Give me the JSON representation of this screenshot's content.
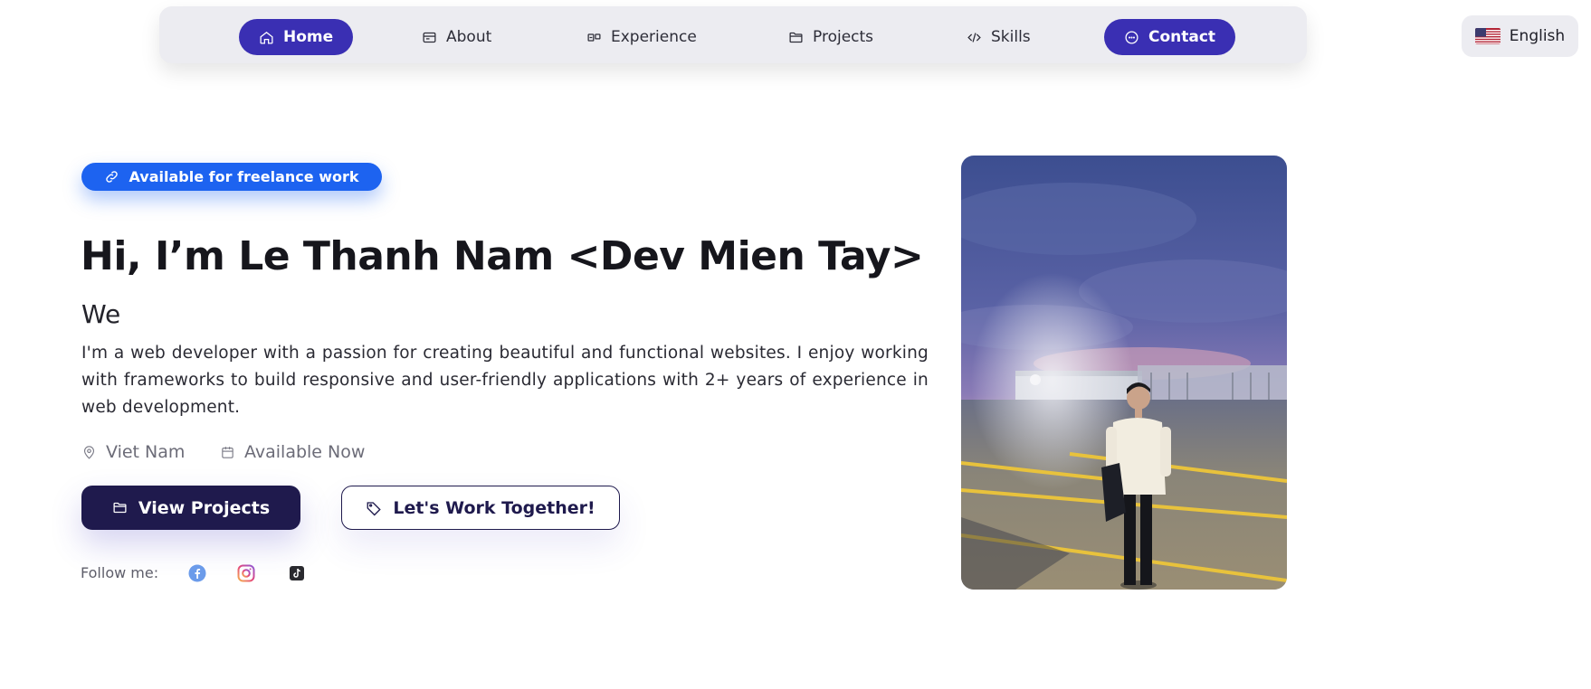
{
  "nav": {
    "items": [
      {
        "label": "Home",
        "icon": "home-icon"
      },
      {
        "label": "About",
        "icon": "id-card-icon"
      },
      {
        "label": "Experience",
        "icon": "briefcase-icon"
      },
      {
        "label": "Projects",
        "icon": "folder-icon"
      },
      {
        "label": "Skills",
        "icon": "code-icon"
      },
      {
        "label": "Contact",
        "icon": "chat-icon"
      }
    ],
    "active_color": "#3a2fb3"
  },
  "language": {
    "label": "English",
    "icon": "us-flag-icon"
  },
  "hero": {
    "badge": "Available for freelance work",
    "title": "Hi, I’m Le Thanh Nam <Dev Mien Tay>",
    "typing_text": "We",
    "bio": "I'm a web developer with a passion for creating beautiful and functional websites. I enjoy working with frameworks to build responsive and user-friendly applications with 2+ years of experience in web development.",
    "location": "Viet Nam",
    "availability": "Available Now",
    "primary_button": "View Projects",
    "secondary_button": "Let's Work Together!",
    "follow_label": "Follow me:",
    "socials": [
      "facebook-icon",
      "instagram-icon",
      "tiktok-icon"
    ]
  },
  "colors": {
    "badge": "#1d63f0",
    "primary_button": "#1f1a4d",
    "nav_background": "#ececf1"
  }
}
